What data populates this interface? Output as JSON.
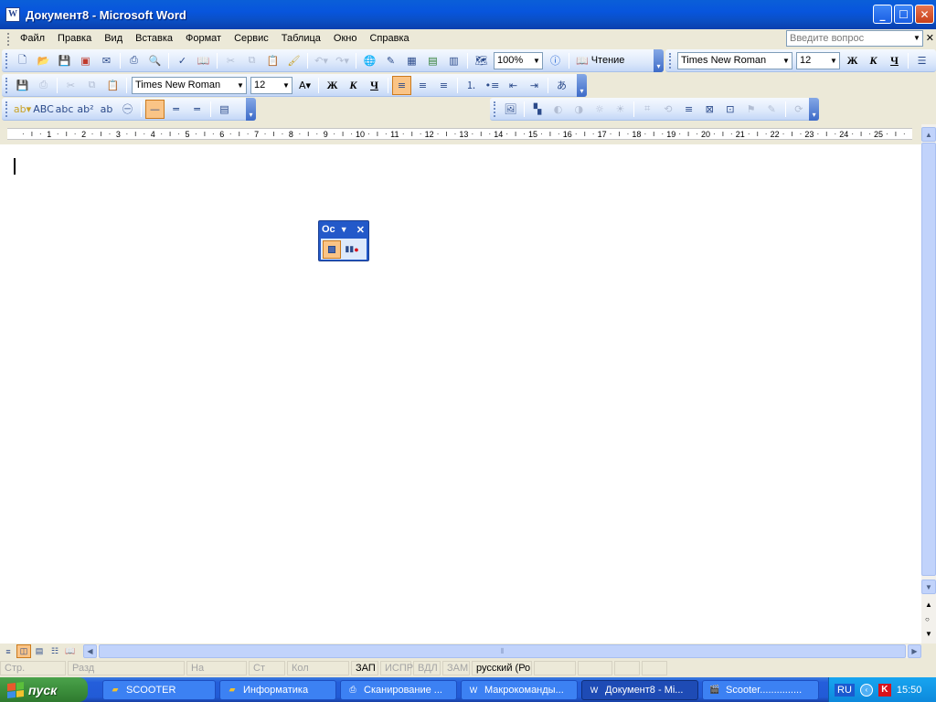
{
  "window": {
    "title": "Документ8 - Microsoft Word",
    "icon": "word-app-icon"
  },
  "menubar": {
    "items": [
      "Файл",
      "Правка",
      "Вид",
      "Вставка",
      "Формат",
      "Сервис",
      "Таблица",
      "Окно",
      "Справка"
    ],
    "ask_placeholder": "Введите вопрос"
  },
  "standard_toolbar": {
    "zoom": "100%",
    "read_label": "Чтение",
    "font": "Times New Roman",
    "size": "12"
  },
  "formatting_toolbar": {
    "font": "Times New Roman",
    "size": "12",
    "bold": "Ж",
    "italic": "К",
    "underline": "Ч"
  },
  "ruler": {
    "numbers": [
      "1",
      "2",
      "3",
      "4",
      "5",
      "6",
      "7",
      "8",
      "9",
      "10",
      "11",
      "12",
      "13",
      "14",
      "15",
      "16",
      "17",
      "18",
      "19",
      "20",
      "21",
      "22",
      "23",
      "24",
      "25"
    ]
  },
  "floating_toolbar": {
    "title": "Ос",
    "buttons": [
      "stop-recording-icon",
      "pause-recording-icon"
    ]
  },
  "statusbar": {
    "fields": [
      "Стр.",
      "Разд",
      "На",
      "Ст",
      "Кол",
      "ЗАП",
      "ИСПР",
      "ВДЛ",
      "ЗАМ",
      "русский (Ро"
    ],
    "enabled": [
      "ЗАП",
      "русский (Ро"
    ]
  },
  "taskbar": {
    "start_label": "пуск",
    "tasks": [
      {
        "label": "SCOOTER",
        "icon": "folder-icon"
      },
      {
        "label": "Информатика",
        "icon": "folder-icon"
      },
      {
        "label": "Сканирование ...",
        "icon": "scanner-icon"
      },
      {
        "label": "Макрокоманды...",
        "icon": "word-doc-icon"
      },
      {
        "label": "Документ8 - Mi...",
        "icon": "word-doc-icon",
        "active": true
      },
      {
        "label": "Scooter...............",
        "icon": "film-icon"
      }
    ],
    "tray": {
      "lang": "RU",
      "time": "15:50"
    }
  },
  "colors": {
    "titlebar": "#0a5fd8",
    "toolbar": "#dde9fb",
    "taskbar": "#245edb",
    "start": "#3c8f3c"
  }
}
